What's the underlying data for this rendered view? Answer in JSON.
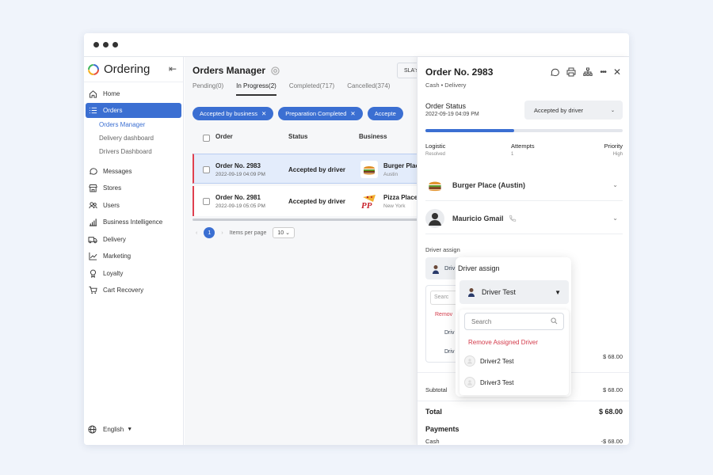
{
  "sidebar": {
    "brand": "Ordering",
    "items": [
      {
        "label": "Home",
        "icon": "home-icon"
      },
      {
        "label": "Orders",
        "icon": "list-icon",
        "active": true
      },
      {
        "label": "Messages",
        "icon": "chat-icon"
      },
      {
        "label": "Stores",
        "icon": "store-icon"
      },
      {
        "label": "Users",
        "icon": "users-icon"
      },
      {
        "label": "Business Intelligence",
        "icon": "chart-icon"
      },
      {
        "label": "Delivery",
        "icon": "truck-icon"
      },
      {
        "label": "Marketing",
        "icon": "trend-icon"
      },
      {
        "label": "Loyalty",
        "icon": "medal-icon"
      },
      {
        "label": "Cart Recovery",
        "icon": "cart-icon"
      }
    ],
    "sub_items": [
      "Orders Manager",
      "Delivery dashboard",
      "Drivers Dashboard"
    ],
    "language": "English"
  },
  "main": {
    "title": "Orders Manager",
    "sla_label": "SLA's",
    "tabs": [
      "Pending(0)",
      "In Progress(2)",
      "Completed(717)",
      "Cancelled(374)"
    ],
    "chips": [
      "Accepted by business",
      "Preparation Completed",
      "Accepte"
    ],
    "columns": [
      "Order",
      "Status",
      "Business"
    ],
    "rows": [
      {
        "order": "Order No. 2983",
        "date": "2022-09-19 04:09 PM",
        "status": "Accepted by driver",
        "business": "Burger Plac",
        "city": "Austin"
      },
      {
        "order": "Order No. 2981",
        "date": "2022-09-19 05:05 PM",
        "status": "Accepted by driver",
        "business": "Pizza Place",
        "city": "New York"
      }
    ],
    "pager": {
      "page": "1",
      "items_per_page_label": "Items per page",
      "items_per_page": "10"
    }
  },
  "panel": {
    "title": "Order No. 2983",
    "subtitle": "Cash • Delivery",
    "status_label": "Order Status",
    "status_date": "2022-09-19 04:09 PM",
    "status_value": "Accepted by driver",
    "progress_fraction": 0.45,
    "meta": [
      {
        "label": "Logistic",
        "value": "Resolved"
      },
      {
        "label": "Attempts",
        "value": "1"
      },
      {
        "label": "Priority",
        "value": "High"
      }
    ],
    "business_name": "Burger Place (Austin)",
    "customer_name": "Mauricio Gmail",
    "driver_assign_label": "Driver assign",
    "under_sel_text": "Driv",
    "under_search": "Searc",
    "under_remove": "Remov",
    "under_driver": "Driv",
    "price_right_1": "$ 68.00",
    "subtotal_label": "Subtotal",
    "subtotal_value": "$ 68.00",
    "total_label": "Total",
    "total_value": "$ 68.00",
    "payments_label": "Payments",
    "cash_label": "Cash",
    "cash_value": "-$ 68.00"
  },
  "popover": {
    "title": "Driver assign",
    "selected": "Driver Test",
    "search_placeholder": "Search",
    "remove_label": "Remove Assigned Driver",
    "drivers": [
      "Driver2 Test",
      "Driver3 Test"
    ]
  },
  "colors": {
    "accent": "#3b6fd2",
    "danger": "#d33a4a",
    "status_bar": "#e04050"
  }
}
